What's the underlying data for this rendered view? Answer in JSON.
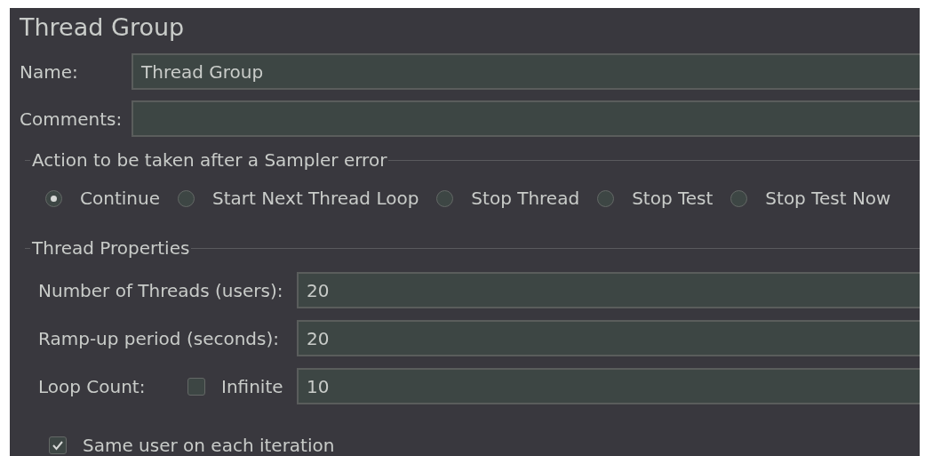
{
  "panel_title": "Thread Group",
  "name": {
    "label": "Name:",
    "value": "Thread Group"
  },
  "comments": {
    "label": "Comments:"
  },
  "error_action": {
    "title": "Action to be taken after a Sampler error",
    "options": [
      {
        "label": "Continue",
        "selected": true
      },
      {
        "label": "Start Next Thread Loop",
        "selected": false
      },
      {
        "label": "Stop Thread",
        "selected": false
      },
      {
        "label": "Stop Test",
        "selected": false
      },
      {
        "label": "Stop Test Now",
        "selected": false
      }
    ]
  },
  "thread_properties": {
    "title": "Thread Properties",
    "fields": [
      {
        "label": "Number of Threads (users):",
        "value": "20"
      },
      {
        "label": "Ramp-up period (seconds):",
        "value": "20"
      }
    ],
    "loop_count": {
      "label": "Loop Count:",
      "infinite": {
        "label": "Infinite",
        "checked": false
      },
      "value": "10"
    },
    "same_user": {
      "label": "Same user on each iteration",
      "checked": true
    }
  }
}
